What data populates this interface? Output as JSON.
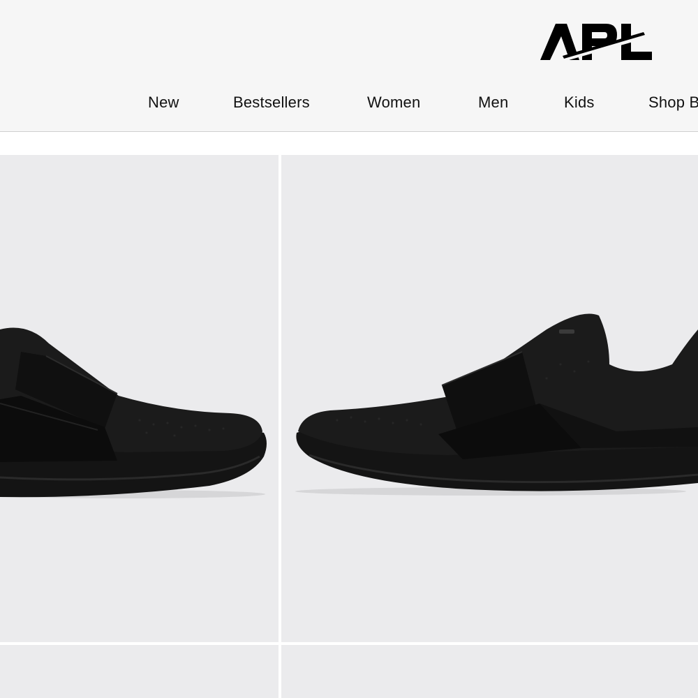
{
  "brand": {
    "logo_text": "APL"
  },
  "nav": {
    "items": [
      {
        "label": "New"
      },
      {
        "label": "Bestsellers"
      },
      {
        "label": "Women"
      },
      {
        "label": "Men"
      },
      {
        "label": "Kids"
      },
      {
        "label": "Shop B"
      }
    ]
  },
  "products": [
    {
      "image": "black-slip-on-sneaker-side"
    },
    {
      "image": "black-slip-on-sneaker-angle"
    },
    {
      "image": "product-image"
    },
    {
      "image": "product-image"
    }
  ],
  "colors": {
    "header_bg": "#f6f6f6",
    "tile_bg": "#ebebed",
    "text": "#111111"
  }
}
